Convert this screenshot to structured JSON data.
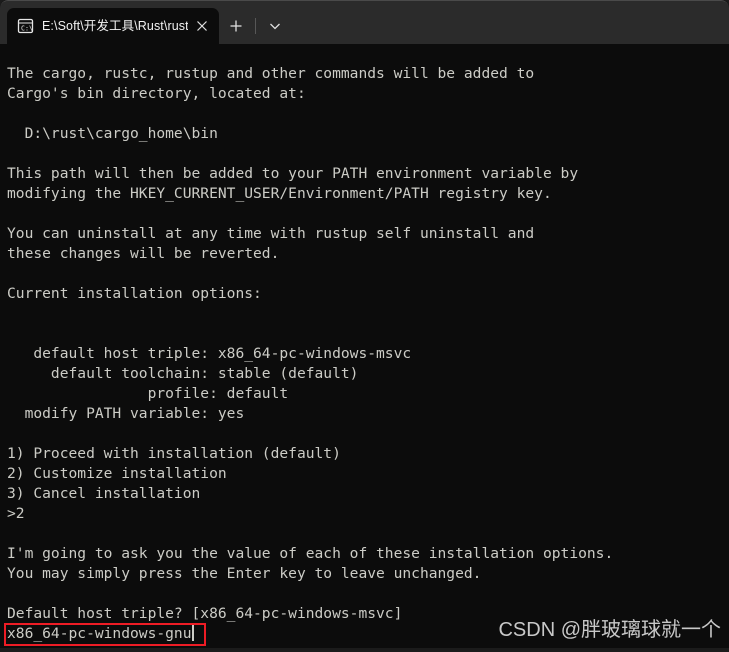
{
  "window": {
    "tab_bar_bg": "#2b2b2b",
    "terminal_bg": "#0c0c0c",
    "text_color": "#ccccc6"
  },
  "tabstrip": {
    "tab": {
      "icon": "command-prompt-icon",
      "title": "E:\\Soft\\开发工具\\Rust\\rustup-",
      "close_label": "✕"
    },
    "new_tab_label": "+",
    "dropdown_label": "⌄"
  },
  "terminal": {
    "lines": [
      "The cargo, rustc, rustup and other commands will be added to",
      "Cargo's bin directory, located at:",
      "",
      "  D:\\rust\\cargo_home\\bin",
      "",
      "This path will then be added to your PATH environment variable by",
      "modifying the HKEY_CURRENT_USER/Environment/PATH registry key.",
      "",
      "You can uninstall at any time with rustup self uninstall and",
      "these changes will be reverted.",
      "",
      "Current installation options:",
      "",
      "",
      "   default host triple: x86_64-pc-windows-msvc",
      "     default toolchain: stable (default)",
      "                profile: default",
      "  modify PATH variable: yes",
      "",
      "1) Proceed with installation (default)",
      "2) Customize installation",
      "3) Cancel installation",
      ">2",
      "",
      "I'm going to ask you the value of each of these installation options.",
      "You may simply press the Enter key to leave unchanged.",
      "",
      "Default host triple? [x86_64-pc-windows-msvc]"
    ],
    "input_line": "x86_64-pc-windows-gnu",
    "cursor_visible": true
  },
  "annotation": {
    "highlight_color": "#ee1c25",
    "highlight_target": "x86_64-pc-windows-gnu"
  },
  "watermark": {
    "text": "CSDN @胖玻璃球就一个"
  }
}
